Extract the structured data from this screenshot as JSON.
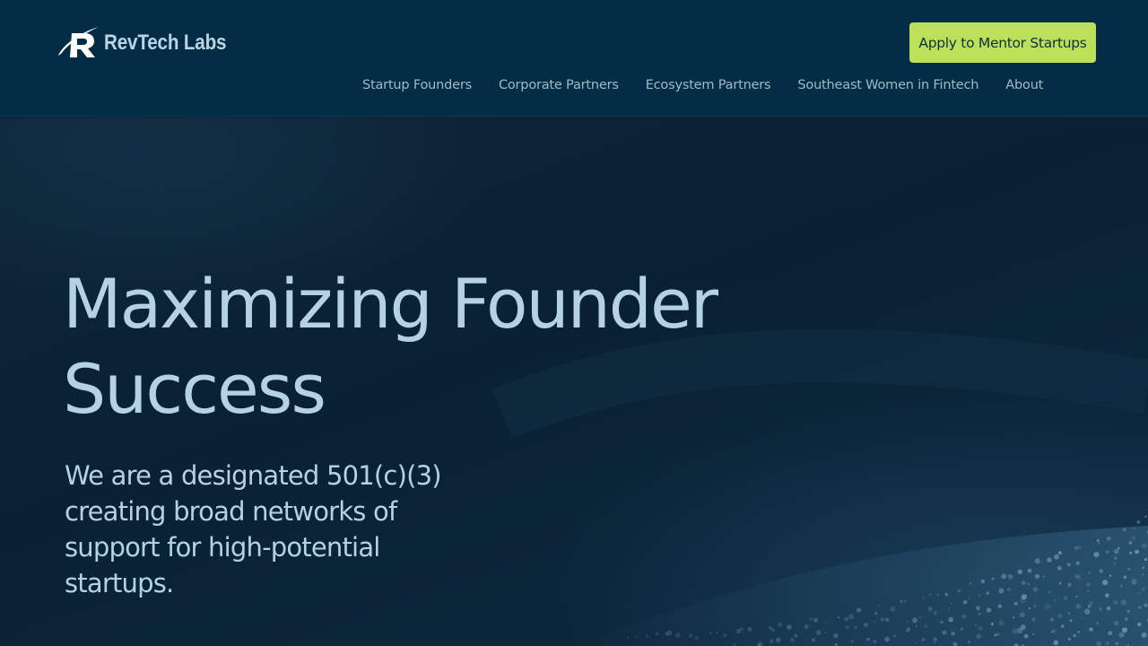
{
  "header": {
    "logo_text": "RevTech Labs",
    "logo_icon": "revtech-r-logo-icon",
    "cta_label": "Apply to Mentor Startups",
    "nav": [
      {
        "label": "Startup Founders"
      },
      {
        "label": "Corporate Partners"
      },
      {
        "label": "Ecosystem Partners"
      },
      {
        "label": "Southeast Women in Fintech"
      },
      {
        "label": "About"
      }
    ]
  },
  "hero": {
    "title_line1": "Maximizing Founder",
    "title_line2": "Success",
    "subtitle": "We are a designated 501(c)(3) creating broad networks of support for high-potential startups."
  },
  "colors": {
    "header_bg": "#042d45",
    "hero_bg": "#0a2134",
    "cta_bg": "#bde05b",
    "text": "#b5d2e2"
  }
}
